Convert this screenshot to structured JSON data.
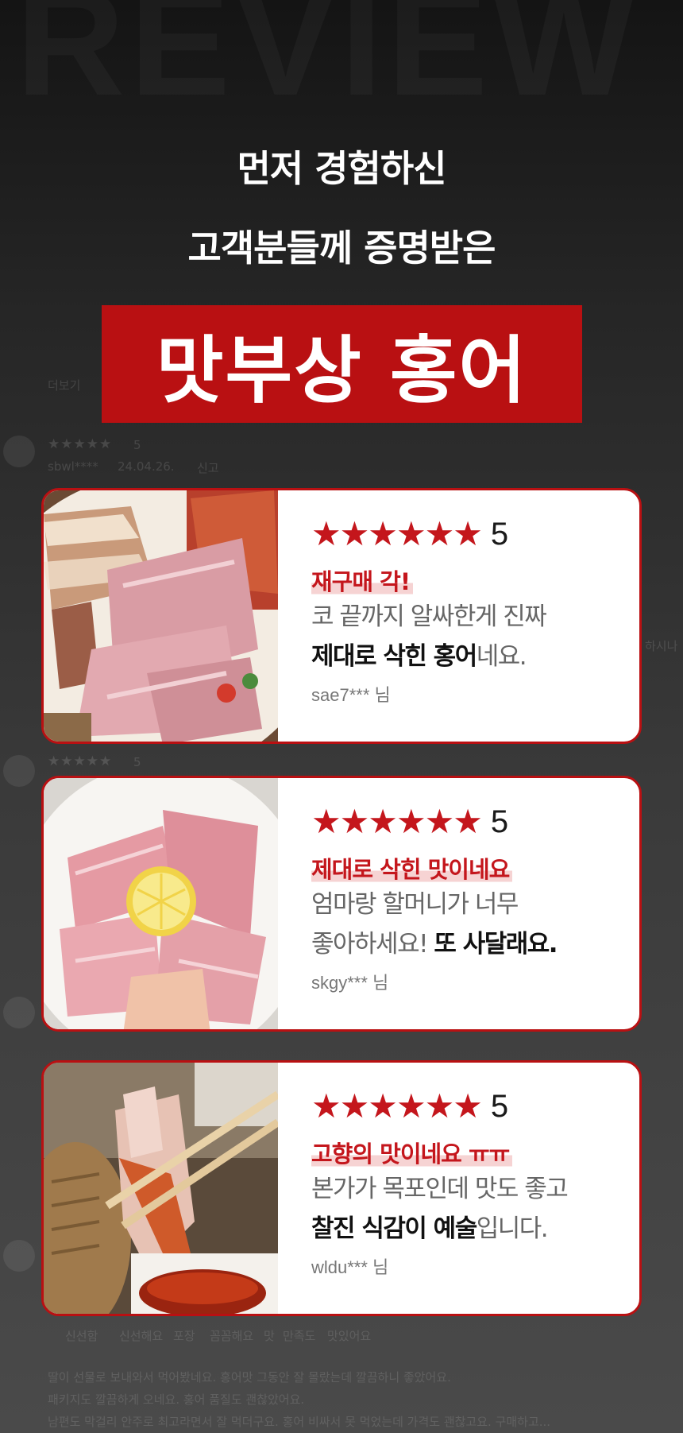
{
  "background": {
    "watermark": "REVIEW",
    "faded_stars": "★★★★★",
    "faded_lines": [
      "5",
      "sbwl****",
      "24.04.26.",
      "신고",
      "더보기",
      "하시나",
      "신선함",
      "신선해요",
      "포장",
      "꼼꼼해요",
      "맛",
      "만족도",
      "맛있어요",
      "딸이 선물로 보내와서 먹어봤네요. 홍어맛 그동안 잘 몰랐는데 깔끔하니 좋았어요.",
      "패키지도 깔끔하게 오네요. 홍어 품질도 괜찮았어요.",
      "남편도 막걸리 안주로 최고라면서 잘 먹더구요. 홍어 비싸서 못 먹었는데 가격도 괜찮고요. 구매하고..."
    ]
  },
  "heading": {
    "line1": "먼저 경험하신",
    "line2": "고객분들께 증명받은",
    "highlight": "맛부상 홍어"
  },
  "colors": {
    "accent": "#c4161c",
    "hero_bg": "#b91012",
    "highlight_bg": "#f6d3d3"
  },
  "reviews": [
    {
      "stars": "★★★★★★",
      "score": "5",
      "title": "재구매 각!",
      "line1": "코 끝까지 알싸한게 진짜",
      "line2_bold": "제대로 삭힌 홍어",
      "line2_rest": "네요.",
      "user": "sae7*** 님",
      "photo": "hongeo-platter-with-pork-and-kimchi"
    },
    {
      "stars": "★★★★★★",
      "score": "5",
      "title": "제대로 삭힌 맛이네요",
      "line1": "엄마랑 할머니가 너무",
      "line2_rest": "좋아하세요!",
      "line2_bold": "또 사달래요.",
      "user": "skgy*** 님",
      "photo": "hongeo-slices-with-lemon"
    },
    {
      "stars": "★★★★★★",
      "score": "5",
      "title": "고향의 맛이네요 ㅠㅠ",
      "line1": "본가가 목포인데 맛도 좋고",
      "line2_bold": "찰진 식감이 예술",
      "line2_rest": "입니다.",
      "user": "wldu*** 님",
      "photo": "hongeo-with-chopsticks-and-sauce"
    }
  ]
}
